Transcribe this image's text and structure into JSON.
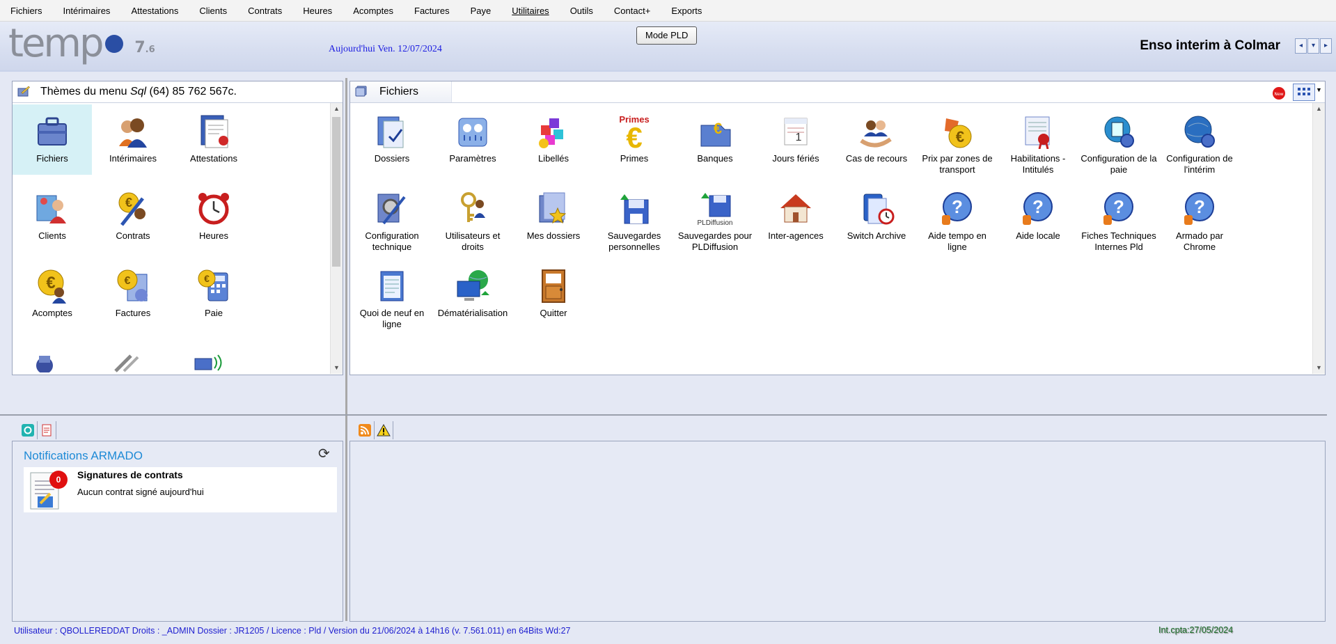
{
  "menu": [
    "Fichiers",
    "Intérimaires",
    "Attestations",
    "Clients",
    "Contrats",
    "Heures",
    "Acomptes",
    "Factures",
    "Paye",
    "Utilitaires",
    "Outils",
    "Contact+",
    "Exports"
  ],
  "header": {
    "logo_text": "tempo",
    "version_major": "7",
    "version_minor": ".6",
    "today": "Aujourd'hui Ven. 12/07/2024",
    "mode_button": "Mode PLD",
    "agency": "Enso interim à Colmar",
    "nav": [
      "◂",
      "▾",
      "▸"
    ]
  },
  "left_panel": {
    "title_prefix": "Thèmes du menu",
    "title_sql": "Sql",
    "title_suffix": "(64)  85 762 567c.",
    "items": [
      {
        "label": "Fichiers",
        "icon": "briefcase-icon"
      },
      {
        "label": "Intérimaires",
        "icon": "workers-icon"
      },
      {
        "label": "Attestations",
        "icon": "certificate-icon"
      },
      {
        "label": "Clients",
        "icon": "client-icon"
      },
      {
        "label": "Contrats",
        "icon": "contract-icon"
      },
      {
        "label": "Heures",
        "icon": "alarm-clock-icon"
      },
      {
        "label": "Acomptes",
        "icon": "euro-worker-icon"
      },
      {
        "label": "Factures",
        "icon": "euro-invoice-icon"
      },
      {
        "label": "Paie",
        "icon": "calculator-icon"
      }
    ]
  },
  "right_panel": {
    "title": "Fichiers",
    "items": [
      {
        "label": "Dossiers",
        "icon": "folder-check-icon"
      },
      {
        "label": "Paramètres",
        "icon": "settings-icon"
      },
      {
        "label": "Libellés",
        "icon": "labels-icon"
      },
      {
        "label": "Primes",
        "icon": "primes-euro-icon"
      },
      {
        "label": "Banques",
        "icon": "bank-euro-icon"
      },
      {
        "label": "Jours fériés",
        "icon": "calendar-icon"
      },
      {
        "label": "Cas de recours",
        "icon": "recourse-icon"
      },
      {
        "label": "Prix par zones de transport",
        "icon": "transport-euro-icon"
      },
      {
        "label": "Habilitations - Intitulés",
        "icon": "habilitation-icon"
      },
      {
        "label": "Configuration de la paie",
        "icon": "payroll-config-icon"
      },
      {
        "label": "Configuration de l'intérim",
        "icon": "interim-config-icon"
      },
      {
        "label": "Configuration technique",
        "icon": "tech-config-icon"
      },
      {
        "label": "Utilisateurs et droits",
        "icon": "users-keys-icon"
      },
      {
        "label": "Mes dossiers",
        "icon": "my-folders-icon"
      },
      {
        "label": "Sauvegardes personnelles",
        "icon": "save-disk-icon"
      },
      {
        "label": "Sauvegardes pour PLDiffusion",
        "icon": "save-pld-icon"
      },
      {
        "label": "Inter-agences",
        "icon": "house-icon"
      },
      {
        "label": "Switch Archive",
        "icon": "archive-icon"
      },
      {
        "label": "Aide tempo en ligne",
        "icon": "help-online-icon"
      },
      {
        "label": "Aide locale",
        "icon": "help-local-icon"
      },
      {
        "label": "Fiches Techniques Internes Pld",
        "icon": "help-tech-icon"
      },
      {
        "label": "Armado par Chrome",
        "icon": "help-chrome-icon"
      },
      {
        "label": "Quoi de neuf en ligne",
        "icon": "notepad-icon"
      },
      {
        "label": "Dématérialisation",
        "icon": "computer-globe-icon"
      },
      {
        "label": "Quitter",
        "icon": "door-icon"
      }
    ]
  },
  "notifications": {
    "title": "Notifications ARMADO",
    "card_title": "Signatures de contrats",
    "card_text": "Aucun contrat signé aujourd'hui",
    "count": "0"
  },
  "status": {
    "left": "Utilisateur : QBOLLEREDDAT   Droits : _ADMIN   Dossier : JR1205  /  Licence : Pld /  Version du 21/06/2024 à 14h16 (v. 7.561.011)  en 64Bits       Wd:27",
    "right": "Int.cpta:27/05/2024"
  },
  "colors": {
    "accent": "#1e8ad6",
    "link_blue": "#2020d0",
    "badge_red": "#e01010",
    "selection": "#d6f1f6"
  }
}
